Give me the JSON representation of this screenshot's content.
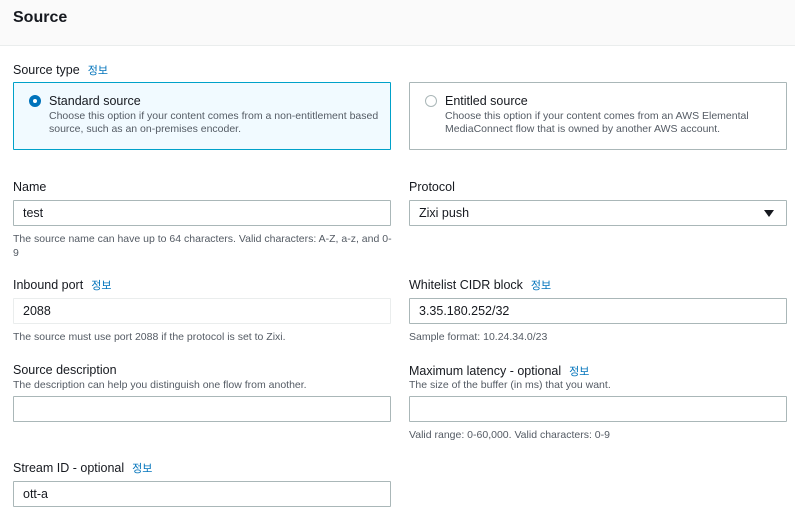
{
  "section": {
    "title": "Source"
  },
  "info_label": "정보",
  "source_type": {
    "label": "Source type",
    "options": [
      {
        "title": "Standard source",
        "description": "Choose this option if your content comes from a non-entitlement based source, such as an on-premises encoder.",
        "selected": true
      },
      {
        "title": "Entitled source",
        "description": "Choose this option if your content comes from an AWS Elemental MediaConnect flow that is owned by another AWS account.",
        "selected": false
      }
    ]
  },
  "name": {
    "label": "Name",
    "value": "test",
    "hint": "The source name can have up to 64 characters. Valid characters: A-Z, a-z, and 0-9"
  },
  "protocol": {
    "label": "Protocol",
    "value": "Zixi push"
  },
  "inbound_port": {
    "label": "Inbound port",
    "value": "2088",
    "hint": "The source must use port 2088 if the protocol is set to Zixi."
  },
  "whitelist": {
    "label": "Whitelist CIDR block",
    "value": "3.35.180.252/32",
    "hint": "Sample format: 10.24.34.0/23"
  },
  "source_description": {
    "label": "Source description",
    "hint": "The description can help you distinguish one flow from another.",
    "value": ""
  },
  "max_latency": {
    "label": "Maximum latency - optional",
    "hint": "The size of the buffer (in ms) that you want.",
    "value": "",
    "hint2": "Valid range: 0-60,000. Valid characters: 0-9"
  },
  "stream_id": {
    "label": "Stream ID - optional",
    "value": "ott-a"
  }
}
